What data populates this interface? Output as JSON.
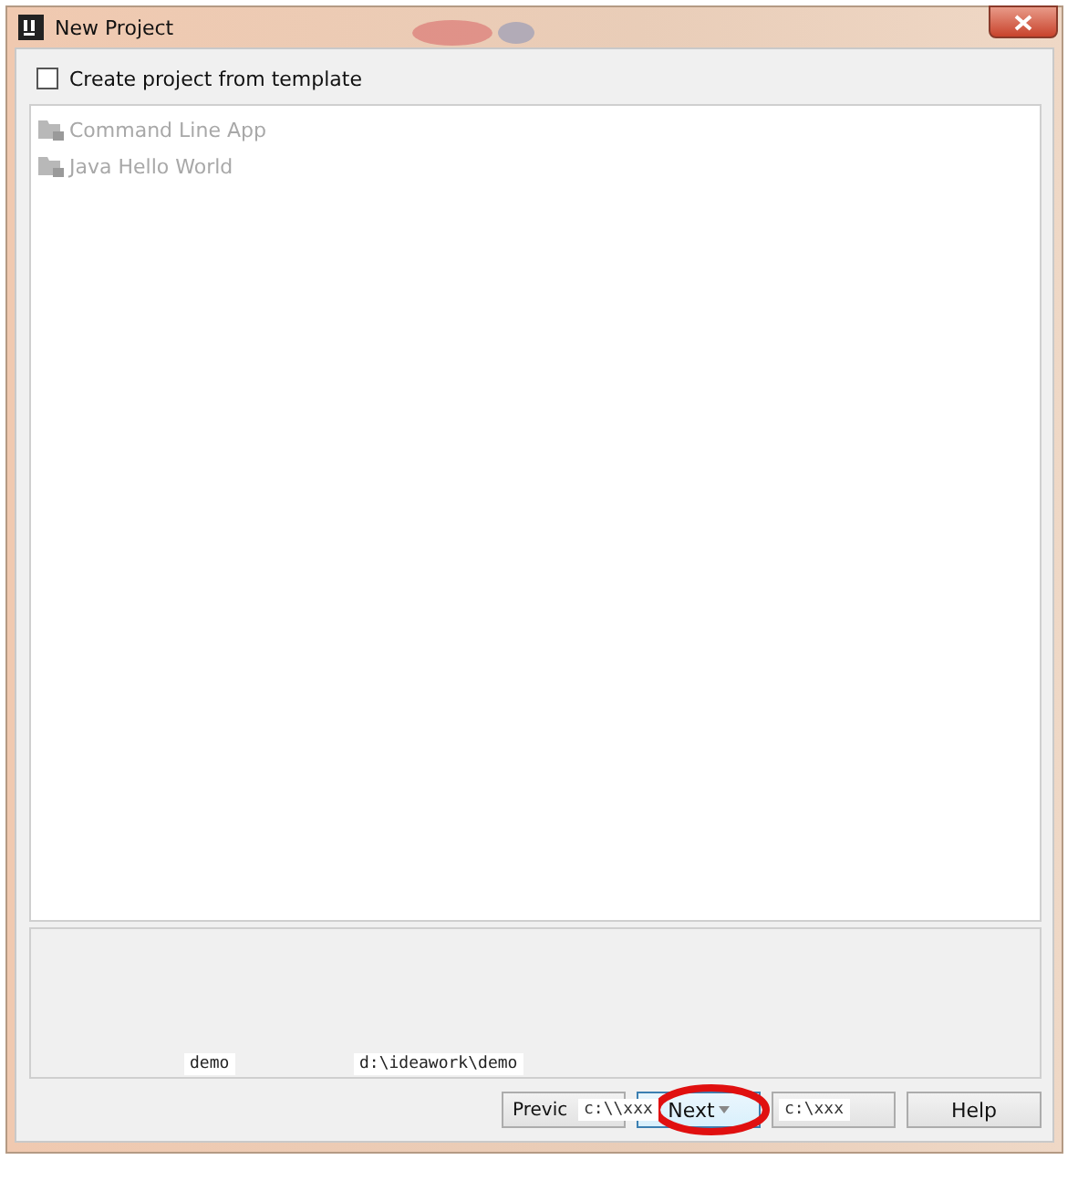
{
  "window": {
    "title": "New Project"
  },
  "template_option": {
    "label": "Create project from template",
    "checked": false
  },
  "templates": [
    {
      "label": "Command Line App",
      "disabled": true
    },
    {
      "label": "Java Hello World",
      "disabled": true
    }
  ],
  "description_tags": [
    {
      "text": "demo"
    },
    {
      "text": "d:\\ideawork\\demo"
    }
  ],
  "buttons": [
    {
      "label": "Previc",
      "kind": "plain",
      "overlay_tag": "c:\\\\xxx"
    },
    {
      "label": "Next",
      "kind": "default"
    },
    {
      "kind": "plain",
      "overlay_tag": "c:\\xxx"
    },
    {
      "label": "Help",
      "kind": "plain"
    }
  ]
}
